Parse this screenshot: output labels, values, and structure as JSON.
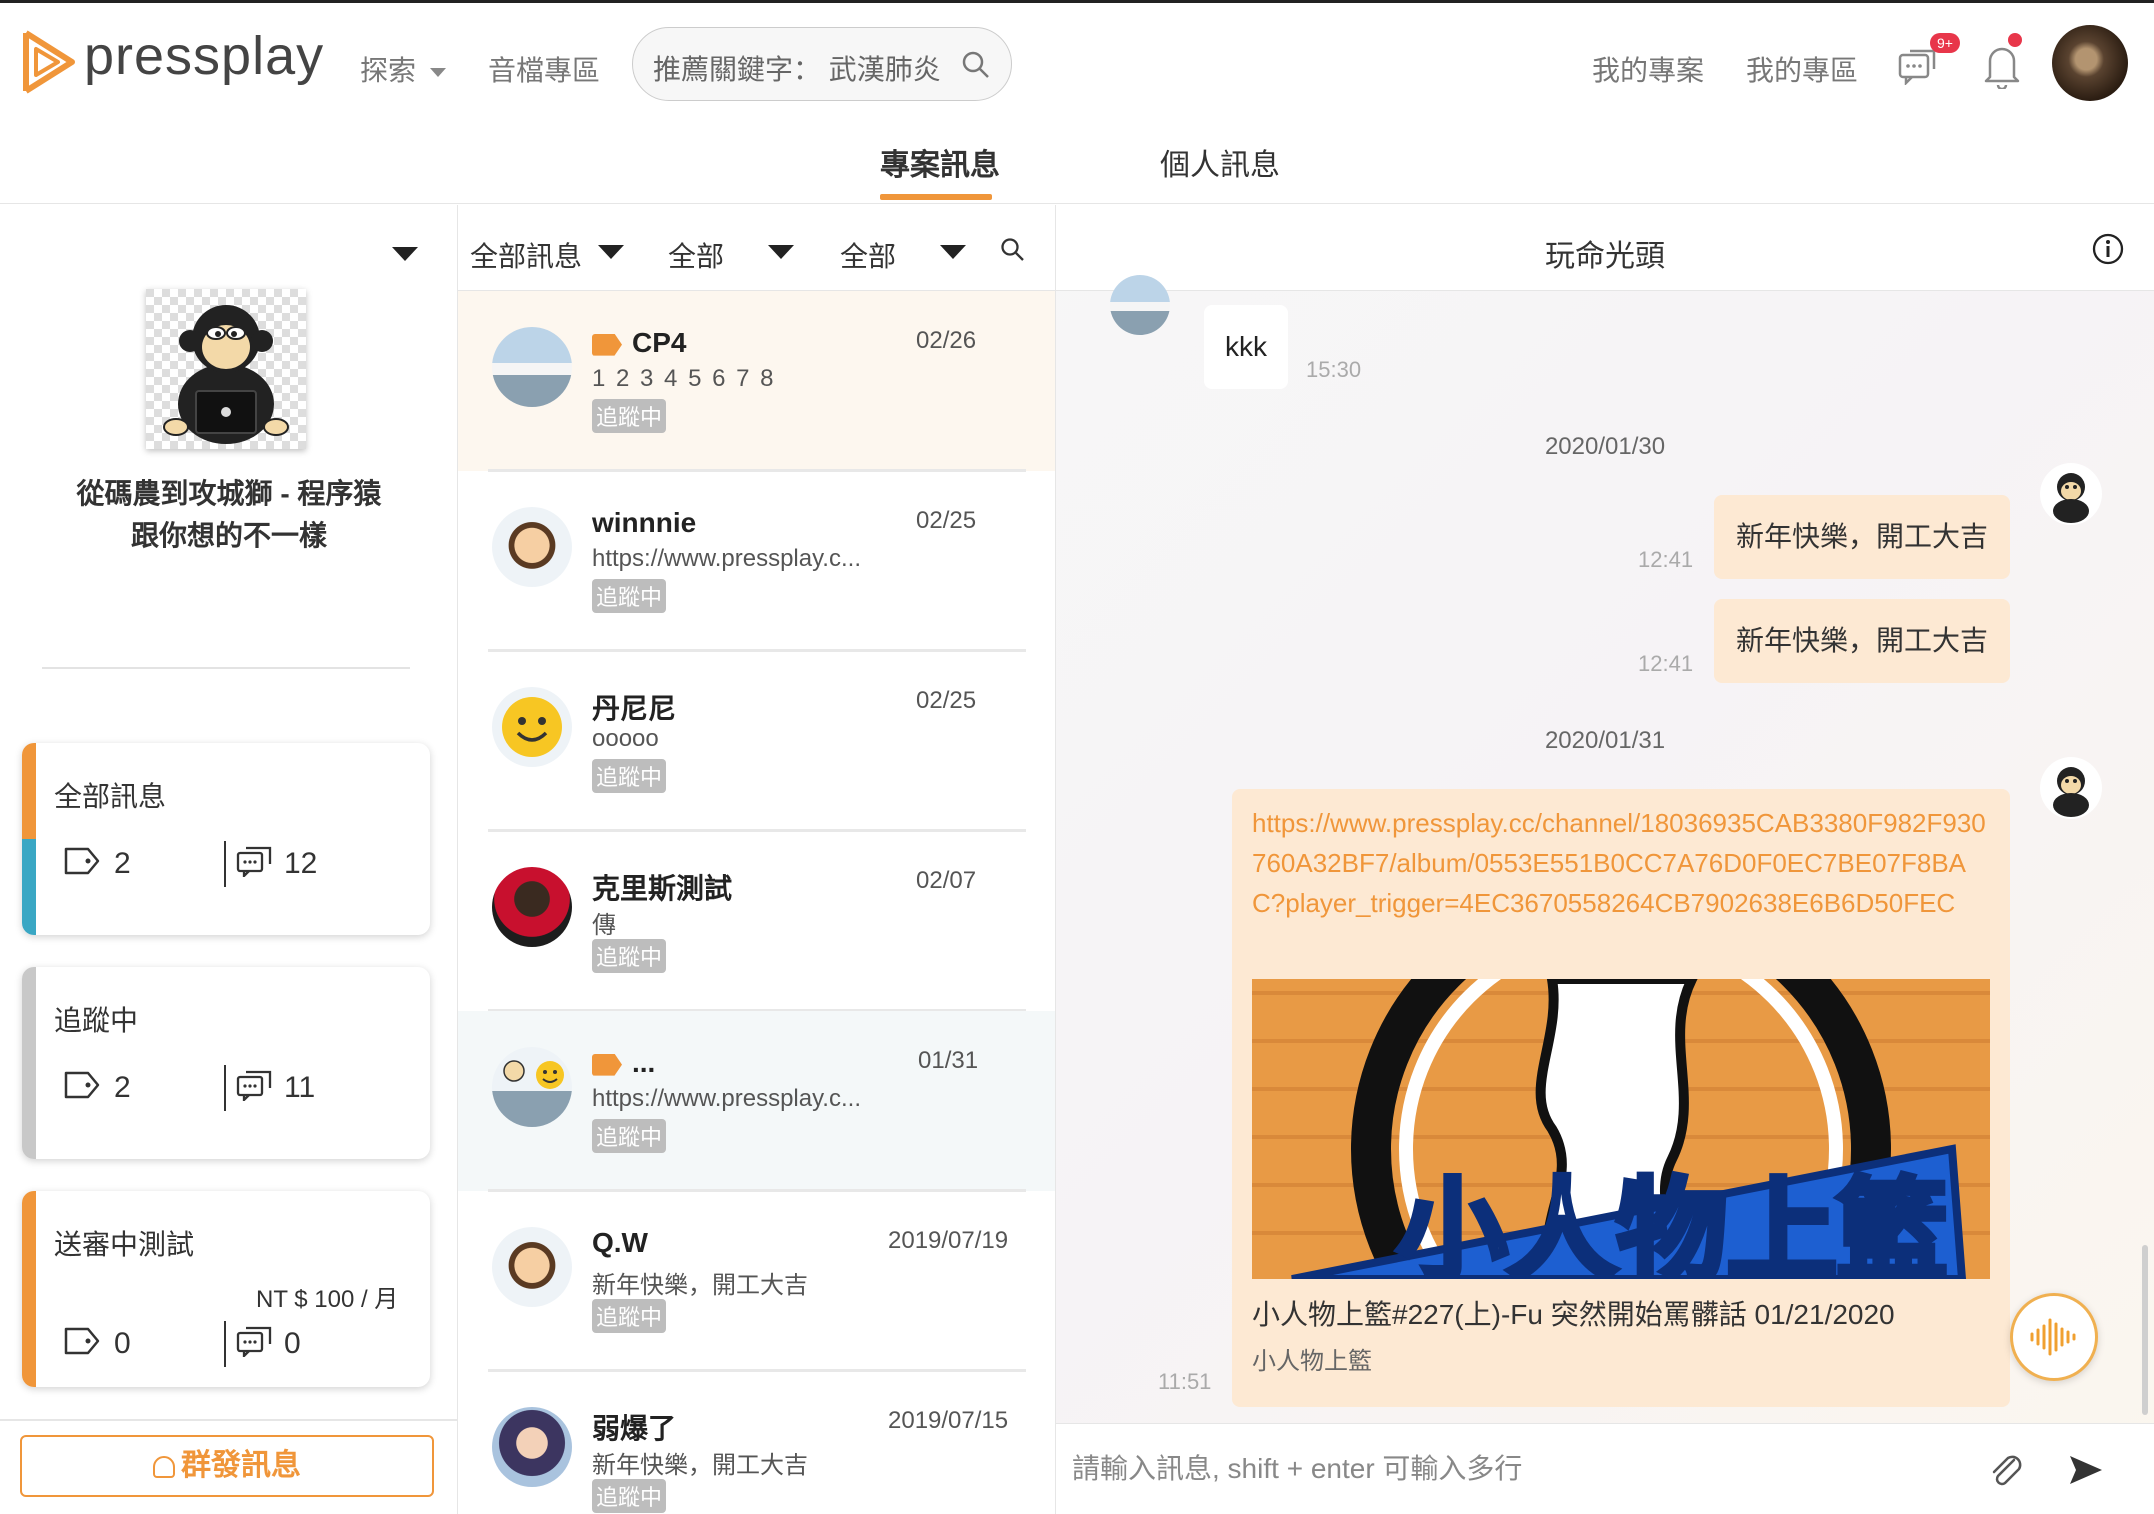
{
  "header": {
    "logo_text": "pressplay",
    "nav_explore": "探索",
    "nav_audio": "音檔專區",
    "search_text": "推薦關鍵字： 武漢肺炎",
    "nav_my_projects": "我的專案",
    "nav_my_zone": "我的專區",
    "message_badge": "9+"
  },
  "tabs": {
    "project": "專案訊息",
    "personal": "個人訊息"
  },
  "left": {
    "project_title_line1": "從碼農到攻城獅 - 程序猿",
    "project_title_line2": "跟你想的不一樣",
    "cards": [
      {
        "title": "全部訊息",
        "tags": "2",
        "msgs": "12",
        "price": ""
      },
      {
        "title": "追蹤中",
        "tags": "2",
        "msgs": "11",
        "price": ""
      },
      {
        "title": "送審中測試",
        "tags": "0",
        "msgs": "0",
        "price": "NT $ 100 / 月"
      }
    ],
    "broadcast": "群發訊息"
  },
  "filters": {
    "f1": "全部訊息",
    "f2": "全部",
    "f3": "全部"
  },
  "conversations": [
    {
      "name": "CP4",
      "date": "02/26",
      "msg": "1 2 3 4 5 6 7 8",
      "tag": "追蹤中",
      "tagged": true
    },
    {
      "name": "winnnie",
      "date": "02/25",
      "msg": "https://www.pressplay.c...",
      "tag": "追蹤中",
      "tagged": false
    },
    {
      "name": "丹尼尼",
      "date": "02/25",
      "msg": "ooooo",
      "tag": "追蹤中",
      "tagged": false
    },
    {
      "name": "克里斯測試",
      "date": "02/07",
      "msg": "傳",
      "tag": "追蹤中",
      "tagged": false
    },
    {
      "name": "...",
      "date": "01/31",
      "msg": "https://www.pressplay.c...",
      "tag": "追蹤中",
      "tagged": true
    },
    {
      "name": "Q.W",
      "date": "2019/07/19",
      "msg": "新年快樂，開工大吉",
      "tag": "追蹤中",
      "tagged": false
    },
    {
      "name": "弱爆了",
      "date": "2019/07/15",
      "msg": "新年快樂，開工大吉",
      "tag": "追蹤中",
      "tagged": false
    }
  ],
  "chat": {
    "title": "玩命光頭",
    "messages": {
      "m1_text": "kkk",
      "m1_time": "15:30",
      "date1": "2020/01/30",
      "m2_text": "新年快樂，開工大吉",
      "m2_time": "12:41",
      "m3_text": "新年快樂，開工大吉",
      "m3_time": "12:41",
      "date2": "2020/01/31",
      "m4_link": "https://www.pressplay.cc/channel/18036935CAB3380F982F930760A32BF7/album/0553E551B0CC7A76D0F0EC7BE07F8BAC?player_trigger=4EC3670558264CB7902638E6B6D50FEC",
      "m4_preview_title": "小人物上籃#227(上)-Fu 突然開始罵髒話 01/21/2020",
      "m4_preview_site": "小人物上籃",
      "m4_time": "11:51",
      "preview_image_text": "小人物上籃"
    },
    "input_placeholder": "請輸入訊息, shift + enter 可輸入多行"
  },
  "colors": {
    "accent": "#f0963a",
    "teal": "#3aa7c4",
    "badge_red": "#e8364a"
  }
}
